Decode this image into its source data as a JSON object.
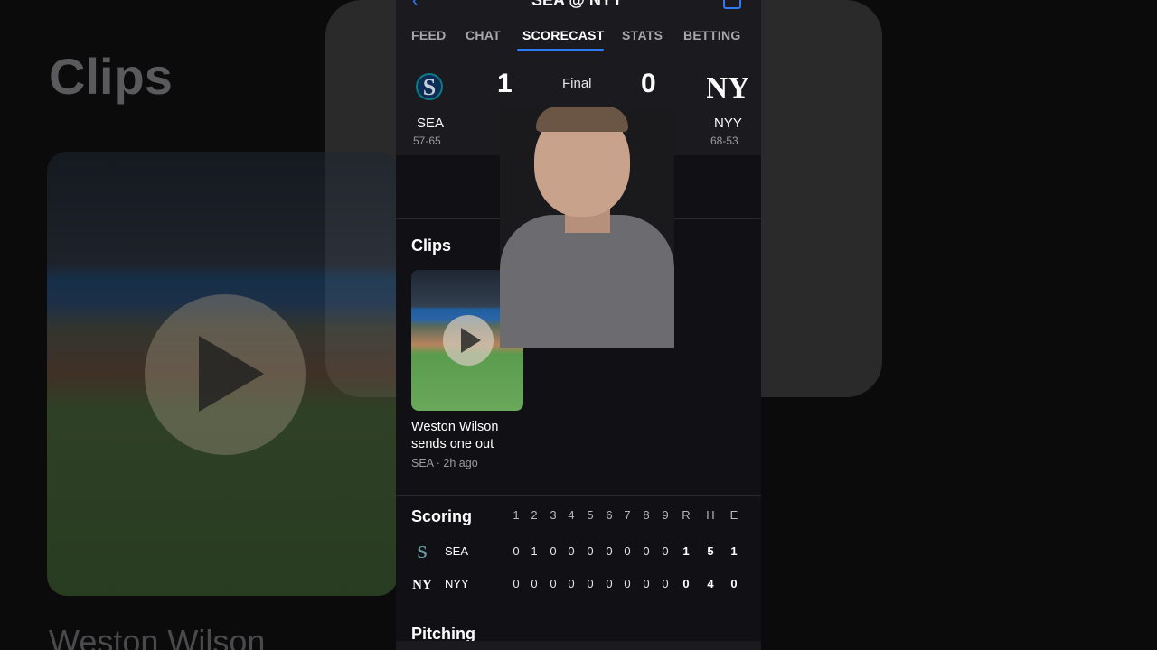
{
  "background": {
    "section_title": "Clips",
    "clip_title": "Weston Wilson"
  },
  "header": {
    "title": "SEA @ NYY"
  },
  "tabs": [
    {
      "label": "FEED"
    },
    {
      "label": "CHAT"
    },
    {
      "label": "SCORECAST"
    },
    {
      "label": "STATS"
    },
    {
      "label": "BETTING"
    }
  ],
  "active_tab": "SCORECAST",
  "game": {
    "status": "Final",
    "away": {
      "abbr": "SEA",
      "record": "57-65",
      "score": "1",
      "logo_glyph": "S",
      "color": "#0c7c87"
    },
    "home": {
      "abbr": "NYY",
      "record": "68-53",
      "score": "0",
      "logo_glyph": "NY",
      "color": "#ffffff"
    }
  },
  "clips": {
    "title": "Clips",
    "items": [
      {
        "title": "Weston Wilson sends one out",
        "meta": "SEA · 2h ago"
      }
    ]
  },
  "scoring": {
    "title": "Scoring",
    "columns": [
      "1",
      "2",
      "3",
      "4",
      "5",
      "6",
      "7",
      "8",
      "9",
      "R",
      "H",
      "E"
    ],
    "rows": [
      {
        "team": "SEA",
        "values": [
          "0",
          "1",
          "0",
          "0",
          "0",
          "0",
          "0",
          "0",
          "0",
          "1",
          "5",
          "1"
        ]
      },
      {
        "team": "NYY",
        "values": [
          "0",
          "0",
          "0",
          "0",
          "0",
          "0",
          "0",
          "0",
          "0",
          "0",
          "4",
          "0"
        ]
      }
    ]
  },
  "pitching": {
    "title": "Pitching"
  },
  "colors": {
    "accent": "#2f7bf5",
    "panel": "#1b1a1e",
    "background": "#111014"
  }
}
